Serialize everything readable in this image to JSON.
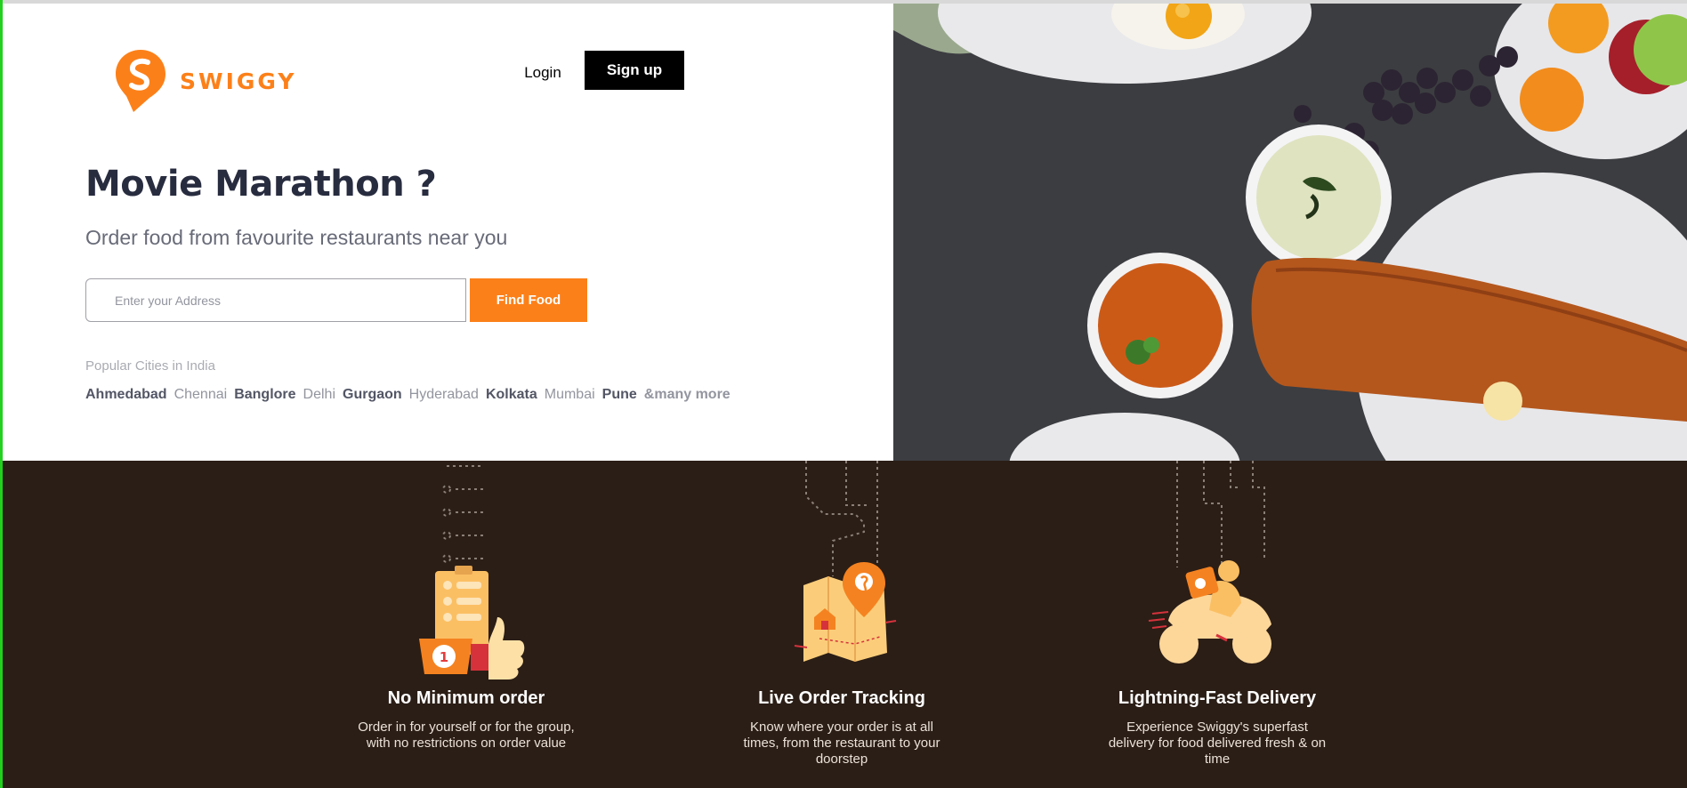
{
  "brand": {
    "name": "SWIGGY",
    "color": "#fc8019"
  },
  "header": {
    "login_label": "Login",
    "signup_label": "Sign up"
  },
  "hero": {
    "headline": "Movie Marathon ?",
    "subline": "Order food from favourite restaurants near you",
    "address_placeholder": "Enter your Address",
    "address_value": "",
    "find_button": "Find Food",
    "popular_label": "Popular Cities in India",
    "cities": [
      {
        "name": "Ahmedabad",
        "tone": "dark"
      },
      {
        "name": "Chennai",
        "tone": "light"
      },
      {
        "name": "Banglore",
        "tone": "dark"
      },
      {
        "name": "Delhi",
        "tone": "light"
      },
      {
        "name": "Gurgaon",
        "tone": "dark"
      },
      {
        "name": "Hyderabad",
        "tone": "light"
      },
      {
        "name": "Kolkata",
        "tone": "dark"
      },
      {
        "name": "Mumbai",
        "tone": "light"
      },
      {
        "name": "Pune",
        "tone": "dark"
      },
      {
        "name": "&many more",
        "tone": "more"
      }
    ]
  },
  "features": [
    {
      "icon": "clipboard-thumbs-up-icon",
      "title": "No Minimum order",
      "description": "Order in for yourself or for the group, with no restrictions on order value"
    },
    {
      "icon": "map-pin-tracking-icon",
      "title": "Live Order Tracking",
      "description": "Know where your order is at all times, from the restaurant to your doorstep"
    },
    {
      "icon": "delivery-scooter-icon",
      "title": "Lightning-Fast Delivery",
      "description": "Experience Swiggy's superfast delivery for food delivered fresh & on time"
    }
  ],
  "colors": {
    "accent": "#fc8019",
    "dark_band": "#2b1e16",
    "heading": "#282c3f"
  }
}
